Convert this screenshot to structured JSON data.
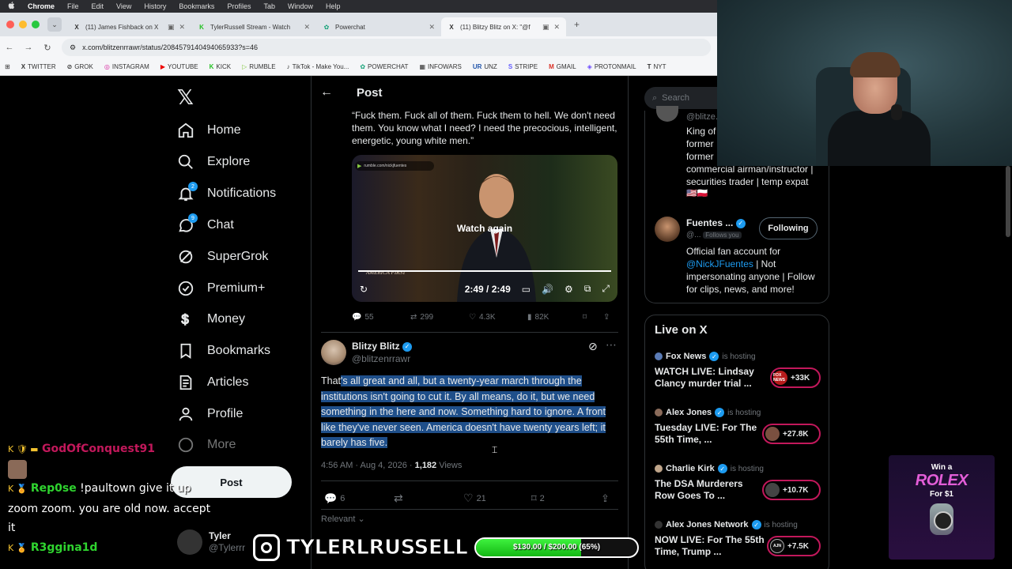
{
  "menubar": {
    "apple": "",
    "items": [
      "Chrome",
      "File",
      "Edit",
      "View",
      "History",
      "Bookmarks",
      "Profiles",
      "Tab",
      "Window",
      "Help"
    ]
  },
  "tabs": [
    {
      "icon": "X",
      "title": "(11) James Fishback on X",
      "active": false
    },
    {
      "icon": "K",
      "title": "TylerRussell Stream - Watch",
      "active": false
    },
    {
      "icon": "✿",
      "title": "Powerchat",
      "active": false
    },
    {
      "icon": "X",
      "title": "(11) Blitzy Blitz on X: \"@f",
      "active": true
    }
  ],
  "address": {
    "url": "x.com/blitzenrrawr/status/2084579140494065933?s=46"
  },
  "bookmarks": [
    {
      "icon": "X",
      "label": "TWITTER"
    },
    {
      "icon": "⊘",
      "label": "GROK"
    },
    {
      "icon": "◎",
      "label": "INSTAGRAM"
    },
    {
      "icon": "▶",
      "label": "YOUTUBE"
    },
    {
      "icon": "K",
      "label": "KICK"
    },
    {
      "icon": "▷",
      "label": "RUMBLE"
    },
    {
      "icon": "♪",
      "label": "TikTok - Make You..."
    },
    {
      "icon": "✿",
      "label": "POWERCHAT"
    },
    {
      "icon": "▦",
      "label": "INFOWARS"
    },
    {
      "icon": "UR",
      "label": "UNZ"
    },
    {
      "icon": "S",
      "label": "STRIPE"
    },
    {
      "icon": "M",
      "label": "GMAIL"
    },
    {
      "icon": "◈",
      "label": "PROTONMAIL"
    },
    {
      "icon": "T",
      "label": "NYT"
    }
  ],
  "nav": {
    "logo": "𝕏",
    "items": [
      {
        "label": "Home",
        "icon": "home-icon"
      },
      {
        "label": "Explore",
        "icon": "search-icon"
      },
      {
        "label": "Notifications",
        "icon": "bell-icon",
        "badge": "2"
      },
      {
        "label": "Chat",
        "icon": "chat-icon",
        "badge": "9"
      },
      {
        "label": "SuperGrok",
        "icon": "grok-icon"
      },
      {
        "label": "Premium+",
        "icon": "premium-icon"
      },
      {
        "label": "Money",
        "icon": "money-icon"
      },
      {
        "label": "Bookmarks",
        "icon": "bookmark-icon"
      },
      {
        "label": "Articles",
        "icon": "articles-icon"
      },
      {
        "label": "Profile",
        "icon": "profile-icon"
      },
      {
        "label": "More",
        "icon": "more-icon"
      }
    ],
    "post_label": "Post",
    "account_name": "Tyler",
    "account_handle": "@Tylerrr"
  },
  "post_header": {
    "title": "Post"
  },
  "quoted": {
    "text": "“Fuck them. Fuck all of them. Fuck them to hell. We don't need them. You know what I need? I need the precocious, intelligent, energetic, young white men.”",
    "video": {
      "source": "rumble.com/nickjfuentes",
      "overlay": "Watch again",
      "time": "2:49 / 2:49",
      "watermark": "AMERICA FIRST",
      "played": 1.0
    },
    "stats": {
      "replies": "55",
      "reposts": "299",
      "likes": "4.3K",
      "views": "82K"
    }
  },
  "tweet": {
    "name": "Blitzy Blitz",
    "handle": "@blitzenrrawr",
    "text_pre": "That",
    "text_selected": "'s all great and all, but a twenty-year march through the institutions isn't going to cut it. By all means, do it, but we need something in the here and now. Something hard to ignore. A front like they've never seen. America doesn't have twenty years left; it barely has five.",
    "time": "4:56 AM · Aug 4, 2026 · ",
    "views_count": "1,182",
    "views_label": " Views",
    "stats": {
      "replies": "6",
      "reposts": "",
      "likes": "21",
      "bookmarks": "2"
    },
    "sort": "Relevant"
  },
  "right": {
    "search_placeholder": "Search",
    "card1": {
      "handle": "@blitze...",
      "bio": "King of\nformer\nformer\ncommercial airman/instructor | securities trader | temp expat",
      "flags": "🇺🇸🇵🇱"
    },
    "card2": {
      "name": "Fuentes ...",
      "handle": "@...",
      "follows_you": "Follows you",
      "follow_label": "Following",
      "bio_pre": "Official fan account for ",
      "bio_link": "@NickJFuentes",
      "bio_post": " | Not impersonating anyone | Follow for clips, news, and more!"
    },
    "live": {
      "heading": "Live on X",
      "items": [
        {
          "host": "Fox News",
          "status": "is hosting",
          "title": "WATCH LIVE: Lindsay Clancy murder trial ...",
          "count": "+33K",
          "avatar": "FOX NEWS"
        },
        {
          "host": "Alex Jones",
          "status": "is hosting",
          "title": "Tuesday LIVE: For The 55th Time, ...",
          "count": "+27.8K",
          "avatar": ""
        },
        {
          "host": "Charlie Kirk",
          "status": "is hosting",
          "title": "The DSA Murderers Row Goes To ...",
          "count": "+10.7K",
          "avatar": ""
        },
        {
          "host": "Alex Jones Network",
          "status": "is hosting",
          "title": "NOW LIVE: For The 55th Time, Trump ...",
          "count": "+7.5K",
          "avatar": "AJN"
        }
      ]
    }
  },
  "overlay": {
    "chat": [
      {
        "user": "GodOfConquest91",
        "msg": ""
      },
      {
        "user": "Rep0se",
        "msg": " !paultown give it up"
      },
      {
        "user": "",
        "msg": "zoom zoom. you are old now. accept"
      },
      {
        "user": "",
        "msg": "it"
      },
      {
        "user": "R3ggina1d",
        "msg": ""
      }
    ],
    "instagram": "TYLERLRUSSELL",
    "goal": {
      "label": "$130.00 / $200.00 (65%)",
      "fraction": 0.65
    },
    "rolex": {
      "win": "Win a",
      "brand": "ROLEX",
      "price": "For $1"
    }
  },
  "colors": {
    "accent": "#1d9bf0",
    "background": "#000000",
    "selection": "#1f4f8a",
    "goal": "#2fd32f",
    "rolex": "#e35ed8"
  }
}
